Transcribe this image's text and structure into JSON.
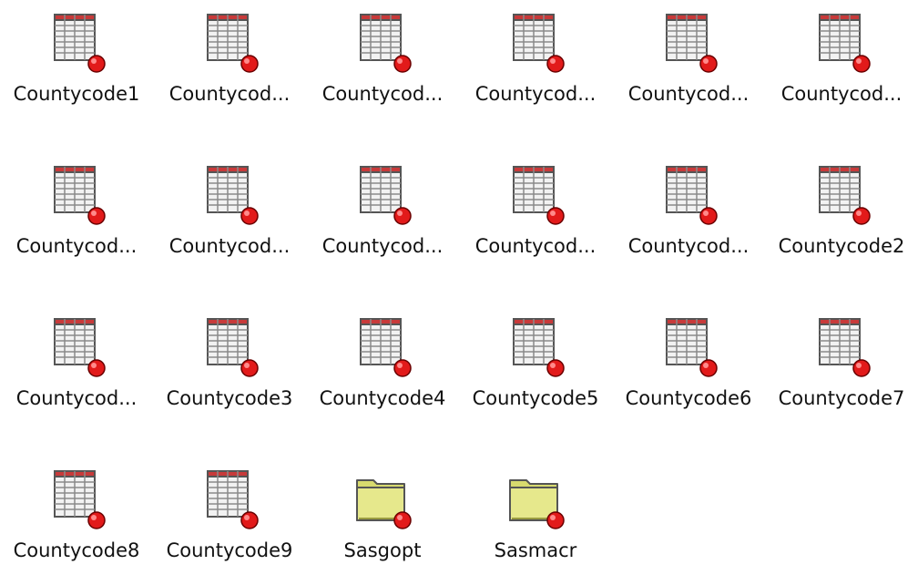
{
  "window": {
    "view": "Large icons"
  },
  "icons": {
    "dataset": "sas-dataset-icon",
    "catalog": "sas-catalog-folder-icon"
  },
  "colors": {
    "background": "#ffffff",
    "table_header": "#c83a3a",
    "table_body": "#f2f2f2",
    "folder": "#e6e88c",
    "badge": "#e21a1a"
  },
  "items": [
    {
      "label": "Countycode1",
      "type": "dataset"
    },
    {
      "label": "Countycod...",
      "type": "dataset"
    },
    {
      "label": "Countycod...",
      "type": "dataset"
    },
    {
      "label": "Countycod...",
      "type": "dataset"
    },
    {
      "label": "Countycod...",
      "type": "dataset"
    },
    {
      "label": "Countycod...",
      "type": "dataset"
    },
    {
      "label": "Countycod...",
      "type": "dataset"
    },
    {
      "label": "Countycod...",
      "type": "dataset"
    },
    {
      "label": "Countycod...",
      "type": "dataset"
    },
    {
      "label": "Countycod...",
      "type": "dataset"
    },
    {
      "label": "Countycod...",
      "type": "dataset"
    },
    {
      "label": "Countycode2",
      "type": "dataset"
    },
    {
      "label": "Countycod...",
      "type": "dataset"
    },
    {
      "label": "Countycode3",
      "type": "dataset"
    },
    {
      "label": "Countycode4",
      "type": "dataset"
    },
    {
      "label": "Countycode5",
      "type": "dataset"
    },
    {
      "label": "Countycode6",
      "type": "dataset"
    },
    {
      "label": "Countycode7",
      "type": "dataset"
    },
    {
      "label": "Countycode8",
      "type": "dataset"
    },
    {
      "label": "Countycode9",
      "type": "dataset"
    },
    {
      "label": "Sasgopt",
      "type": "catalog"
    },
    {
      "label": "Sasmacr",
      "type": "catalog"
    }
  ]
}
